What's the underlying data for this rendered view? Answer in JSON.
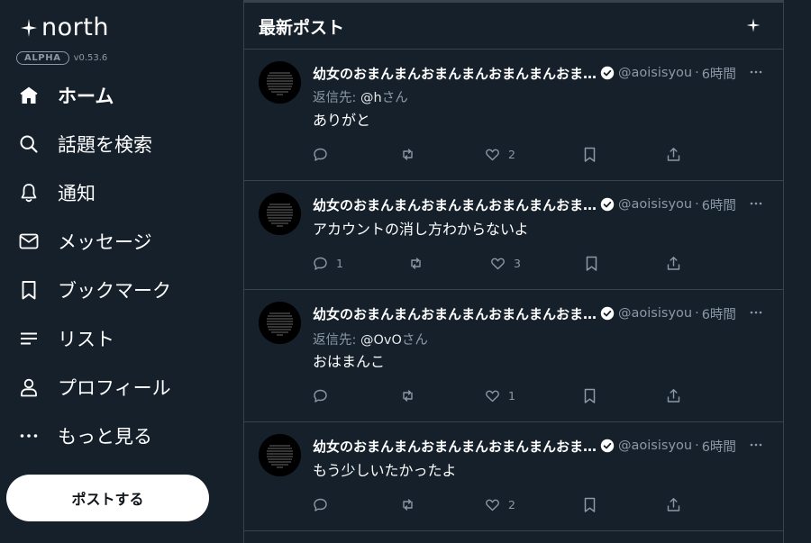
{
  "app": {
    "logo_text": "north",
    "alpha_label": "ALPHA",
    "version": "v0.53.6"
  },
  "nav": {
    "items": [
      {
        "label": "ホーム",
        "icon": "home-icon",
        "active": true
      },
      {
        "label": "話題を検索",
        "icon": "search-icon"
      },
      {
        "label": "通知",
        "icon": "bell-icon"
      },
      {
        "label": "メッセージ",
        "icon": "mail-icon"
      },
      {
        "label": "ブックマーク",
        "icon": "bookmark-icon"
      },
      {
        "label": "リスト",
        "icon": "list-icon"
      },
      {
        "label": "プロフィール",
        "icon": "user-icon"
      },
      {
        "label": "もっと見る",
        "icon": "more-icon"
      }
    ],
    "post_button": "ポストする"
  },
  "timeline": {
    "title": "最新ポスト",
    "posts": [
      {
        "name": "幼女のおまんまんおまんまんおまんまんおま…",
        "handle": "@aoisisyou",
        "time": "6時間",
        "reply_prefix": "返信先: ",
        "reply_to": "@h",
        "reply_suffix": "さん",
        "text": "ありがと",
        "replies": "",
        "reposts": "",
        "likes": "2"
      },
      {
        "name": "幼女のおまんまんおまんまんおまんまんおま…",
        "handle": "@aoisisyou",
        "time": "6時間",
        "text": "アカウントの消し方わからないよ",
        "replies": "1",
        "reposts": "",
        "likes": "3"
      },
      {
        "name": "幼女のおまんまんおまんまんおまんまんおま…",
        "handle": "@aoisisyou",
        "time": "6時間",
        "reply_prefix": "返信先: ",
        "reply_to": "@OvO",
        "reply_suffix": "さん",
        "text": "おはまんこ",
        "replies": "",
        "reposts": "",
        "likes": "1"
      },
      {
        "name": "幼女のおまんまんおまんまんおまんまんおま…",
        "handle": "@aoisisyou",
        "time": "6時間",
        "text": "もう少しいたかったよ",
        "replies": "",
        "reposts": "",
        "likes": "2"
      }
    ]
  },
  "colors": {
    "background": "#15202b",
    "border": "#38444d",
    "muted_text": "#8b98a5",
    "primary_text": "#ffffff"
  }
}
